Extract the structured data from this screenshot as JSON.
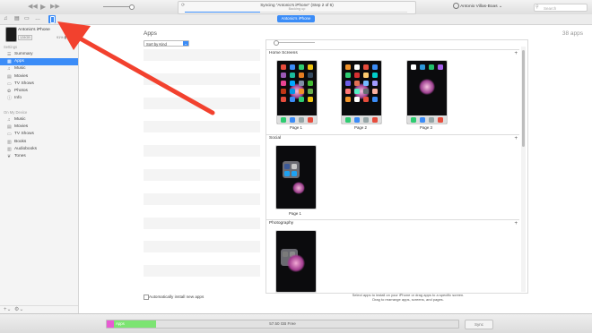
{
  "titlebar": {
    "lcd_line1": "Syncing “Antonio's iPhone” (Step 2 of 6)",
    "lcd_line2": "Backing up",
    "progress_fraction": 0.34,
    "account_name": "Antonio Villas-Boas",
    "account_chevron": "⌄",
    "search_placeholder": "Search"
  },
  "toolbar": {
    "device_pill": "Antonio's iPhone"
  },
  "device": {
    "name": "Antonio's iPhone",
    "storage": "128GB",
    "battery": "91% ▮"
  },
  "sidebar": {
    "settings_header": "Settings",
    "settings_items": [
      {
        "label": "Summary",
        "icon": "summary-icon",
        "selected": false
      },
      {
        "label": "Apps",
        "icon": "apps-icon",
        "selected": true
      },
      {
        "label": "Music",
        "icon": "music-icon",
        "selected": false
      },
      {
        "label": "Movies",
        "icon": "movies-icon",
        "selected": false
      },
      {
        "label": "TV Shows",
        "icon": "tv-icon",
        "selected": false
      },
      {
        "label": "Photos",
        "icon": "photos-icon",
        "selected": false
      },
      {
        "label": "Info",
        "icon": "info-icon",
        "selected": false
      }
    ],
    "device_header": "On My Device",
    "device_items": [
      {
        "label": "Music",
        "icon": "music-icon"
      },
      {
        "label": "Movies",
        "icon": "movies-icon"
      },
      {
        "label": "TV Shows",
        "icon": "tv-icon"
      },
      {
        "label": "Books",
        "icon": "books-icon"
      },
      {
        "label": "Audiobooks",
        "icon": "audiobooks-icon"
      },
      {
        "label": "Tones",
        "icon": "tones-icon"
      }
    ]
  },
  "main": {
    "title": "Apps",
    "count": "38 apps",
    "sort_label": "Sort by Kind",
    "sections": [
      {
        "title": "Home Screens",
        "pages": [
          "Page 1",
          "Page 2",
          "Page 3"
        ]
      },
      {
        "title": "Social",
        "pages": [
          "Page 1"
        ]
      },
      {
        "title": "Photography",
        "pages": []
      }
    ],
    "add_symbol": "+",
    "auto_install_label": "Automatically install new apps",
    "footer_hint_line1": "Select apps to install on your iPhone or drag apps to a specific screen.",
    "footer_hint_line2": "Drag to rearrange apps, screens, and pages."
  },
  "status": {
    "apps_label": "Apps",
    "apps_fraction": 0.14,
    "free_label": "57.50 GB Free",
    "sync_label": "Sync"
  },
  "colors": {
    "accent": "#3b8cf7",
    "arrow": "#f2412e",
    "apps_bar": "#7ce472"
  }
}
